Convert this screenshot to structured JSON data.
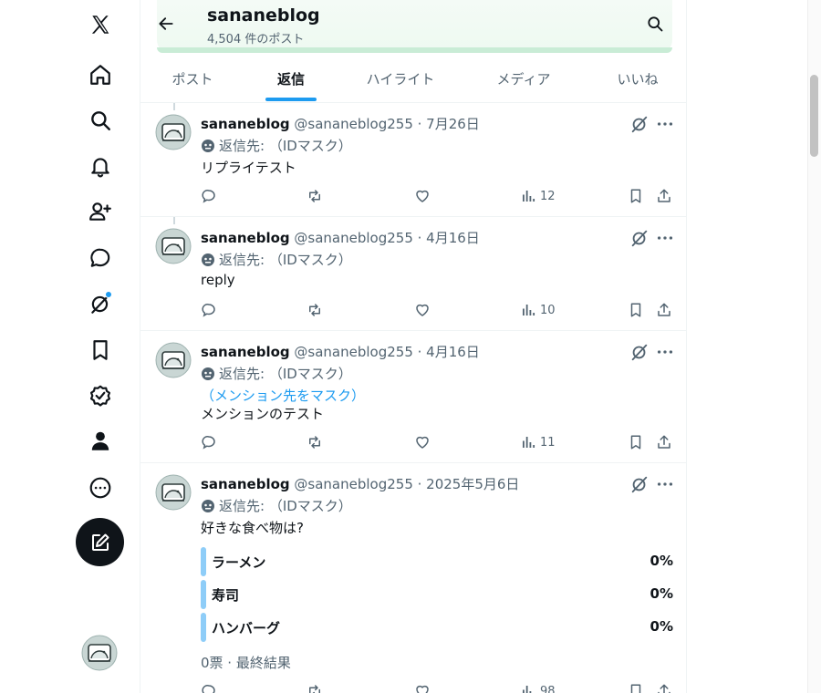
{
  "header": {
    "profile_name": "sananeblog",
    "post_count": "4,504 件のポスト"
  },
  "tabs": [
    {
      "label": "ポスト"
    },
    {
      "label": "返信"
    },
    {
      "label": "ハイライト"
    },
    {
      "label": "メディア"
    },
    {
      "label": "いいね"
    }
  ],
  "active_tab": "返信",
  "accent_color": "#1d9bf0",
  "nav": {
    "icons": [
      "x-logo-icon",
      "home-icon",
      "search-icon",
      "notifications-icon",
      "follow-icon",
      "messages-icon",
      "grok-icon",
      "bookmarks-icon",
      "verified-icon",
      "profile-icon",
      "more-icon"
    ],
    "compose_icon": "compose-icon"
  },
  "posts": [
    {
      "name": "sananeblog",
      "handle": "@sananeblog255 · 7月26日",
      "reply_to": "返信先: （IDマスク）",
      "text": "リプライテスト",
      "views": "12"
    },
    {
      "name": "sananeblog",
      "handle": "@sananeblog255 · 4月16日",
      "reply_to": "返信先: （IDマスク）",
      "text": "reply",
      "views": "10"
    },
    {
      "name": "sananeblog",
      "handle": "@sananeblog255 · 4月16日",
      "reply_to": "返信先: （IDマスク）",
      "mention": "（メンション先をマスク）",
      "text": "メンションのテスト",
      "views": "11"
    },
    {
      "name": "sananeblog",
      "handle": "@sananeblog255 · 2025年5月6日",
      "reply_to": "返信先: （IDマスク）",
      "text": "好きな食べ物は?",
      "poll": [
        {
          "label": "ラーメン",
          "pct": "0%"
        },
        {
          "label": "寿司",
          "pct": "0%"
        },
        {
          "label": "ハンバーグ",
          "pct": "0%"
        }
      ],
      "poll_result": "0票 · 最終結果",
      "views": "98"
    }
  ]
}
